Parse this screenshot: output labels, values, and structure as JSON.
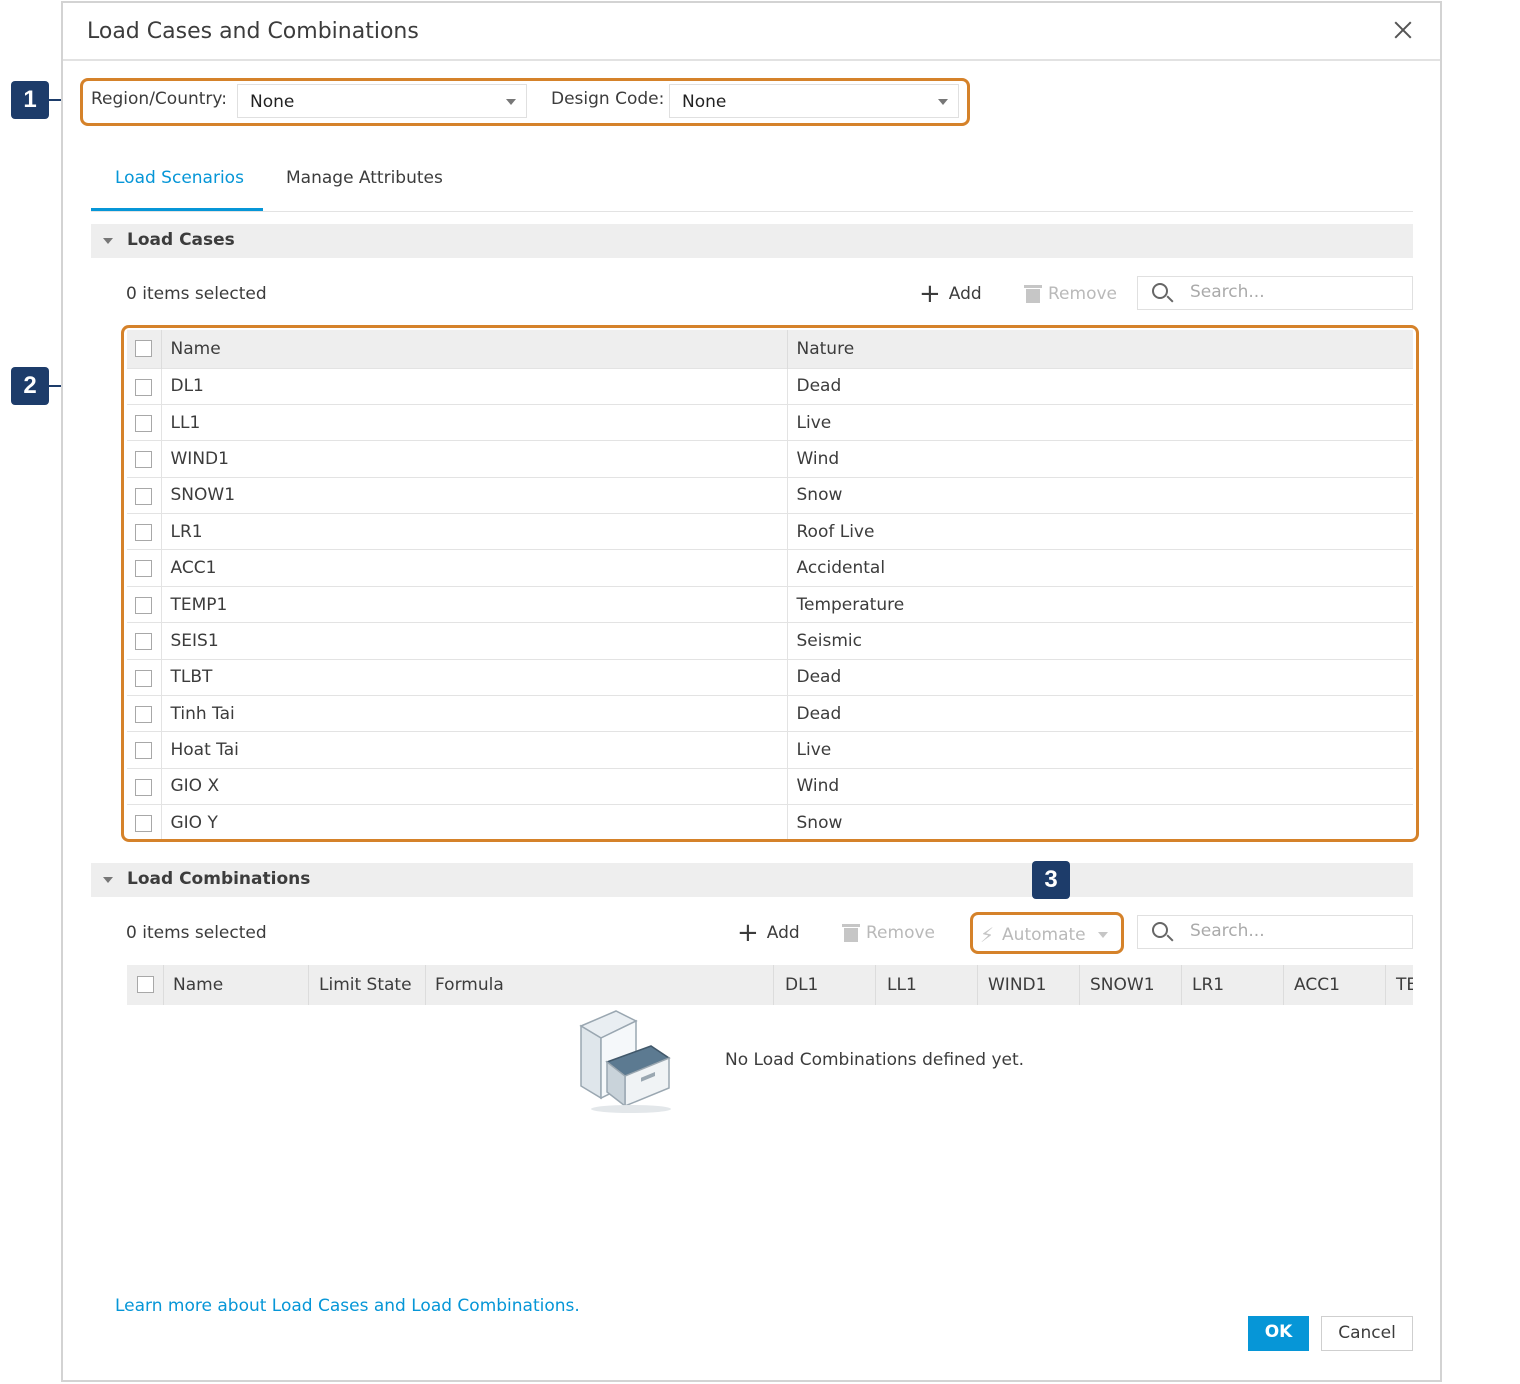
{
  "dialog": {
    "title": "Load Cases and Combinations",
    "region_label": "Region/Country:",
    "region_value": "None",
    "design_code_label": "Design Code:",
    "design_code_value": "None",
    "tabs": [
      {
        "label": "Load Scenarios",
        "active": true
      },
      {
        "label": "Manage Attributes",
        "active": false
      }
    ]
  },
  "load_cases": {
    "section_title": "Load Cases",
    "selected_count": "0 items selected",
    "add_label": "Add",
    "remove_label": "Remove",
    "search_placeholder": "Search...",
    "columns": [
      "Name",
      "Nature"
    ],
    "rows": [
      {
        "name": "DL1",
        "nature": "Dead"
      },
      {
        "name": "LL1",
        "nature": "Live"
      },
      {
        "name": "WIND1",
        "nature": "Wind"
      },
      {
        "name": "SNOW1",
        "nature": "Snow"
      },
      {
        "name": "LR1",
        "nature": "Roof Live"
      },
      {
        "name": "ACC1",
        "nature": "Accidental"
      },
      {
        "name": "TEMP1",
        "nature": "Temperature"
      },
      {
        "name": "SEIS1",
        "nature": "Seismic"
      },
      {
        "name": "TLBT",
        "nature": "Dead"
      },
      {
        "name": "Tinh Tai",
        "nature": "Dead"
      },
      {
        "name": "Hoat Tai",
        "nature": "Live"
      },
      {
        "name": "GIO X",
        "nature": "Wind"
      },
      {
        "name": "GIO Y",
        "nature": "Snow"
      }
    ]
  },
  "load_combinations": {
    "section_title": "Load Combinations",
    "selected_count": "0 items selected",
    "add_label": "Add",
    "remove_label": "Remove",
    "automate_label": "Automate",
    "search_placeholder": "Search...",
    "columns": [
      "Name",
      "Limit State",
      "Formula",
      "DL1",
      "LL1",
      "WIND1",
      "SNOW1",
      "LR1",
      "ACC1",
      "TE"
    ],
    "empty_message": "No Load Combinations defined yet."
  },
  "footer": {
    "learn_more": "Learn more about Load Cases and Load Combinations.",
    "ok_label": "OK",
    "cancel_label": "Cancel"
  },
  "callouts": [
    "1",
    "2",
    "3"
  ],
  "colors": {
    "accent": "#0696d7",
    "highlight": "#d5822a",
    "callout": "#1d3c6a"
  }
}
